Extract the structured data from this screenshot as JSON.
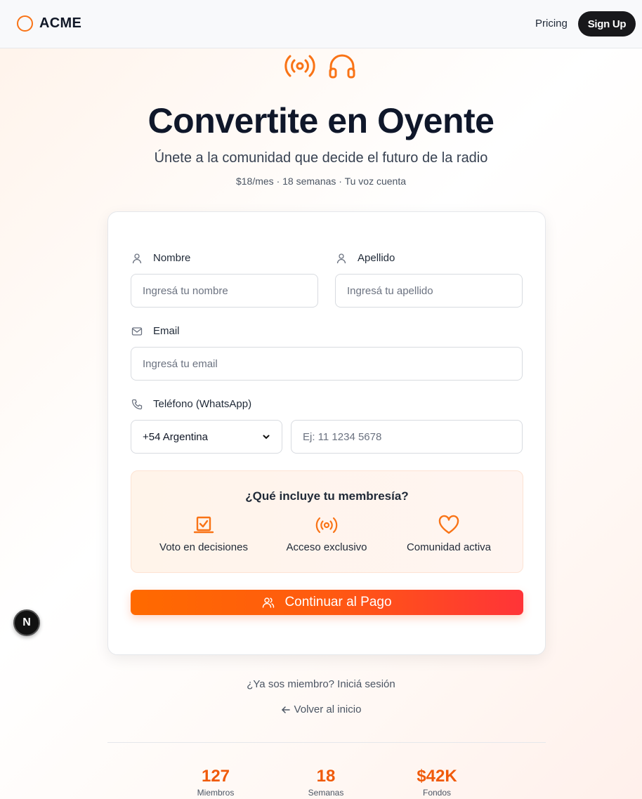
{
  "header": {
    "brand": "ACME",
    "nav_pricing": "Pricing",
    "signup_label": "Sign Up"
  },
  "hero": {
    "icons": [
      "broadcast-icon",
      "headphones-icon"
    ],
    "title": "Convertite en Oyente",
    "subtitle": "Únete a la comunidad que decide el futuro de la radio",
    "meta": "$18/mes · 18 semanas · Tu voz cuenta"
  },
  "form": {
    "first_name": {
      "label": "Nombre",
      "placeholder": "Ingresá tu nombre"
    },
    "last_name": {
      "label": "Apellido",
      "placeholder": "Ingresá tu apellido"
    },
    "email": {
      "label": "Email",
      "placeholder": "Ingresá tu email"
    },
    "phone": {
      "label": "Teléfono (WhatsApp)",
      "country_selected": "+54 Argentina",
      "placeholder": "Ej: 11 1234 5678"
    }
  },
  "benefits": {
    "title": "¿Qué incluye tu membresía?",
    "items": [
      {
        "icon": "vote-icon",
        "label": "Voto en decisiones"
      },
      {
        "icon": "broadcast-icon",
        "label": "Acceso exclusivo"
      },
      {
        "icon": "heart-icon",
        "label": "Comunidad activa"
      }
    ]
  },
  "cta_label": "Continuar al Pago",
  "login_prompt": "¿Ya sos miembro? Iniciá sesión",
  "back_label": "Volver al inicio",
  "stats": [
    {
      "value": "127",
      "label": "Miembros"
    },
    {
      "value": "18",
      "label": "Semanas"
    },
    {
      "value": "$42K",
      "label": "Fondos"
    }
  ],
  "dev_badge": "N",
  "colors": {
    "accent": "#f97316",
    "cta_start": "#ff6a00",
    "cta_end": "#ff3438",
    "dark": "#18181b"
  }
}
